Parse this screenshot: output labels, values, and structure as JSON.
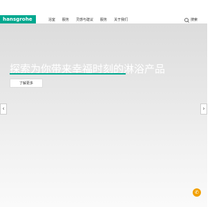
{
  "header": {
    "logo_text": "hansgrohe",
    "nav": [
      "浴室",
      "服务",
      "灵感与建议",
      "服务",
      "关于我们"
    ],
    "search_label": "搜索"
  },
  "hero": {
    "title": "探索为你带来幸福时刻的淋浴产品",
    "button_label": "了解更多"
  },
  "colors": {
    "accent": "#00a88f",
    "chat": "#f2a000"
  },
  "icons": {
    "search": "search-icon",
    "prev": "chevron-left-icon",
    "next": "chevron-right-icon",
    "chat": "chat-icon"
  }
}
